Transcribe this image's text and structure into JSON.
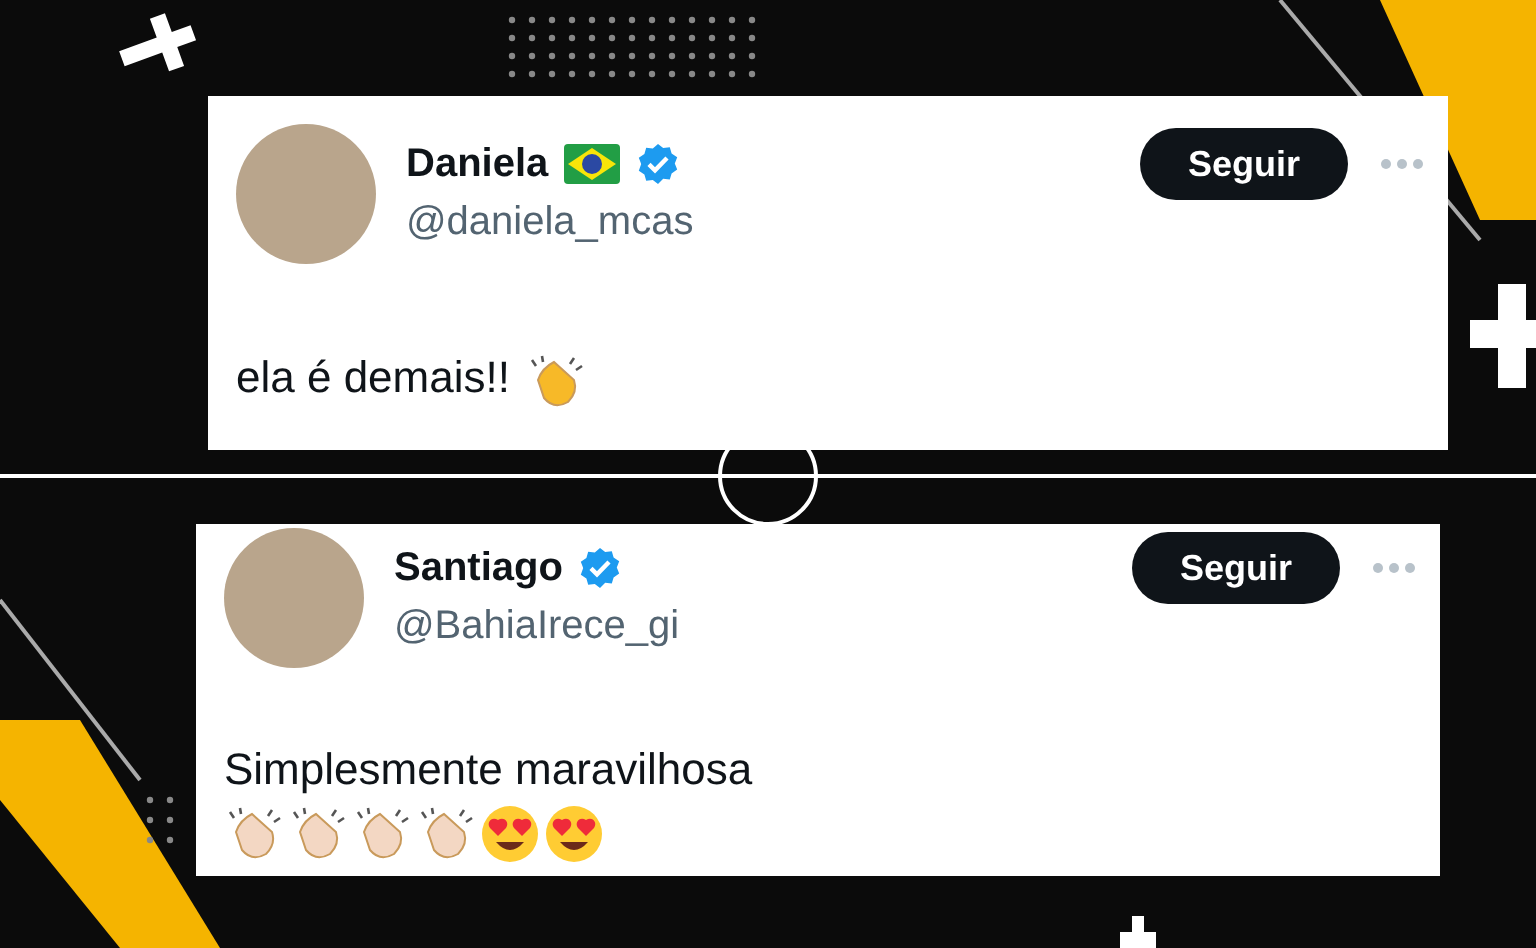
{
  "tweets": [
    {
      "name": "Daniela",
      "flag": true,
      "verified": true,
      "handle": "@daniela_mcas",
      "button": "Seguir",
      "text": "ela é demais!!",
      "emojis": [
        {
          "kind": "clap-yellow"
        }
      ]
    },
    {
      "name": "Santiago",
      "flag": false,
      "verified": true,
      "handle": "@BahiaIrece_gi",
      "button": "Seguir",
      "text": "Simplesmente maravilhosa",
      "emojis": [
        {
          "kind": "clap-light"
        },
        {
          "kind": "clap-light"
        },
        {
          "kind": "clap-light"
        },
        {
          "kind": "clap-light"
        },
        {
          "kind": "heart-eyes"
        },
        {
          "kind": "heart-eyes"
        }
      ]
    }
  ]
}
